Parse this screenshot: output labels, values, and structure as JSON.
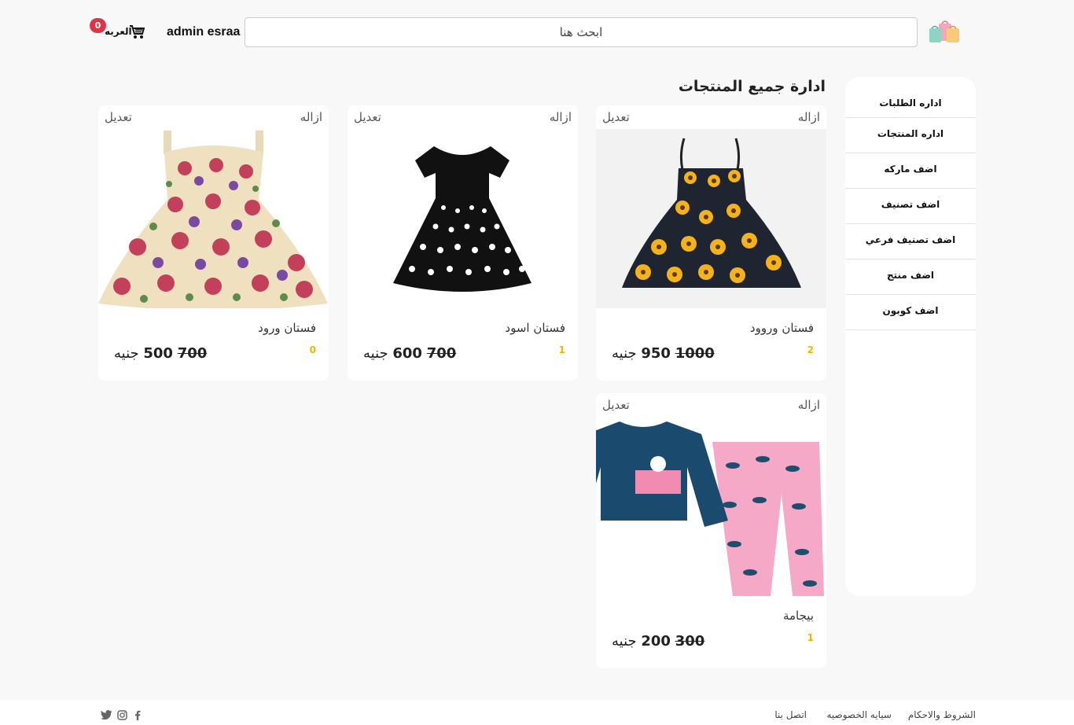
{
  "header": {
    "search_placeholder": "ابحث هنا",
    "username": "admin esraa",
    "cart_label": "العربه",
    "cart_count": "0"
  },
  "page_title": "ادارة جميع المنتجات",
  "sidebar": {
    "items": [
      {
        "label": "اداره الطلبات"
      },
      {
        "label": "اداره المنتجات"
      },
      {
        "label": "اضف ماركه"
      },
      {
        "label": "اضف تصنيف"
      },
      {
        "label": "اضف تصنيف فرعي"
      },
      {
        "label": "اضف منتج"
      },
      {
        "label": "اضف كوبون"
      }
    ]
  },
  "card_actions": {
    "remove": "ازاله",
    "edit": "تعديل"
  },
  "currency": "جنيه",
  "products": [
    {
      "name": "فستان وروود",
      "rating": "2",
      "old_price": "1000",
      "new_price": "950",
      "image": "sunflower-dress-image"
    },
    {
      "name": "فستان اسود",
      "rating": "1",
      "old_price": "700",
      "new_price": "600",
      "image": "black-polka-dress-image"
    },
    {
      "name": "فستان ورود",
      "rating": "0",
      "old_price": "700",
      "new_price": "500",
      "image": "floral-dress-image"
    },
    {
      "name": "بيجامة",
      "rating": "1",
      "old_price": "300",
      "new_price": "200",
      "image": "pajama-image"
    }
  ],
  "footer": {
    "terms": "الشروط والاحكام",
    "privacy": "سيايه الخصوصيه",
    "contact": "اتصل بنا",
    "social_icons": [
      "facebook-icon",
      "instagram-icon",
      "twitter-icon"
    ]
  },
  "colors": {
    "badge": "#dc3545",
    "rating": "#f0b400",
    "background": "#f8f8f8"
  }
}
